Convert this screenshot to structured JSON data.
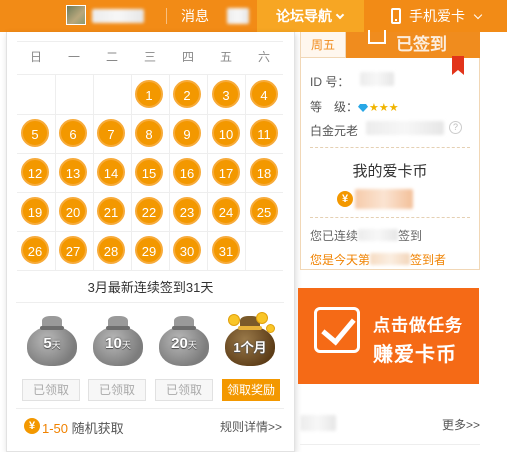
{
  "topbar": {
    "messages_label": "消息",
    "forum_nav_label": "论坛导航",
    "mobile_label": "手机爱卡"
  },
  "calendar": {
    "weekdays": [
      "日",
      "一",
      "二",
      "三",
      "四",
      "五",
      "六"
    ],
    "days": [
      "1",
      "2",
      "3",
      "4",
      "5",
      "6",
      "7",
      "8",
      "9",
      "10",
      "11",
      "12",
      "13",
      "14",
      "15",
      "16",
      "17",
      "18",
      "19",
      "20",
      "21",
      "22",
      "23",
      "24",
      "25",
      "26",
      "27",
      "28",
      "29",
      "30",
      "31"
    ],
    "caption": "3月最新连续签到31天"
  },
  "rewards": [
    {
      "badge": "5",
      "unit": "天",
      "button": "已领取",
      "claimed": true
    },
    {
      "badge": "10",
      "unit": "天",
      "button": "已领取",
      "claimed": true
    },
    {
      "badge": "20",
      "unit": "天",
      "button": "已领取",
      "claimed": true
    },
    {
      "badge": "1个月",
      "unit": "",
      "button": "领取奖励",
      "claimed": false
    }
  ],
  "popup_footer": {
    "coin_symbol": "¥",
    "range": "1-50",
    "random_label": "随机获取",
    "rules_link": "规则详情>>"
  },
  "right_panel": {
    "date_tab": "周五",
    "signin_label": "已签到",
    "id_label": "ID 号：",
    "level_label": "等　级：",
    "level_stars": "★★★",
    "platinum_label": "白金元老",
    "help_icon_text": "?",
    "coins_title": "我的爱卡币",
    "coin_symbol": "¥",
    "streak_prefix": "您已连续",
    "streak_suffix": "签到",
    "rank_prefix": "您是今天第",
    "rank_suffix": "签到者"
  },
  "promo": {
    "line1": "点击做任务",
    "line2": "赚爱卡币"
  },
  "more_link": "更多>>",
  "colors": {
    "primary_orange": "#f28b16",
    "day_orange": "#f39800",
    "promo_orange": "#f56a16"
  }
}
